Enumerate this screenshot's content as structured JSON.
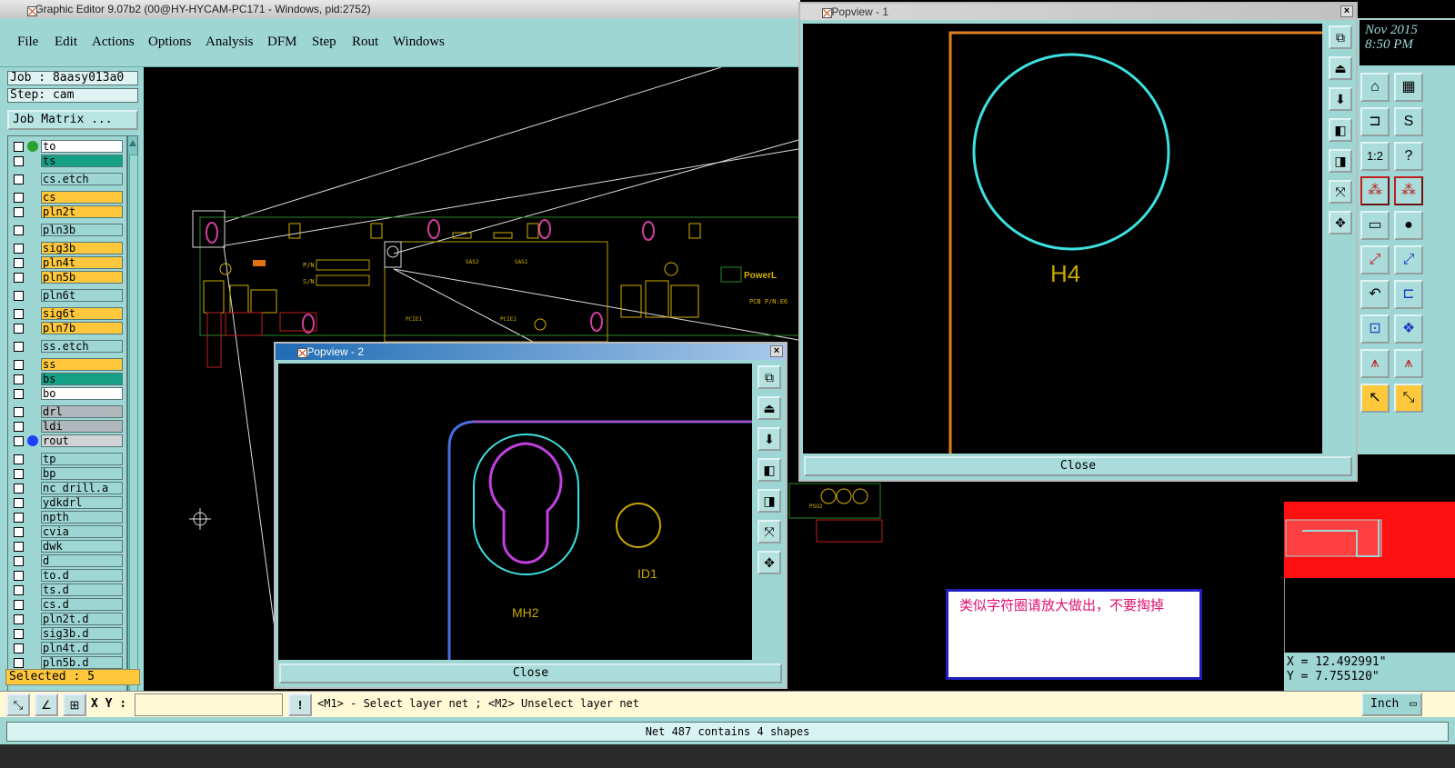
{
  "window": {
    "title": "Graphic Editor 9.07b2 (00@HY-HYCAM-PC171 - Windows, pid:2752)"
  },
  "clock": {
    "date": "Nov 2015",
    "time": "8:50 PM"
  },
  "menu": [
    "File",
    "Edit",
    "Actions",
    "Options",
    "Analysis",
    "DFM",
    "Step",
    "Rout",
    "Windows"
  ],
  "job": {
    "job_label": "Job : 8aasy013a0",
    "step_label": "Step: cam",
    "matrix_button": "Job Matrix ..."
  },
  "layers": [
    {
      "name": "to",
      "color": "#ffffff",
      "dot": "#2ca02c"
    },
    {
      "name": "ts",
      "color": "#16a085"
    },
    {
      "name": "cs.etch",
      "color": "#9ed6d4"
    },
    {
      "name": "cs",
      "color": "#ffc83c"
    },
    {
      "name": "pln2t",
      "color": "#ffc83c"
    },
    {
      "name": "pln3b",
      "color": "#9ed6d4"
    },
    {
      "name": "sig3b",
      "color": "#ffc83c"
    },
    {
      "name": "pln4t",
      "color": "#ffc83c"
    },
    {
      "name": "pln5b",
      "color": "#ffc83c"
    },
    {
      "name": "pln6t",
      "color": "#9ed6d4"
    },
    {
      "name": "sig6t",
      "color": "#ffc83c"
    },
    {
      "name": "pln7b",
      "color": "#ffc83c"
    },
    {
      "name": "ss.etch",
      "color": "#9ed6d4"
    },
    {
      "name": "ss",
      "color": "#ffc83c"
    },
    {
      "name": "bs",
      "color": "#16a085"
    },
    {
      "name": "bo",
      "color": "#ffffff"
    },
    {
      "name": "drl",
      "color": "#b0b8bc"
    },
    {
      "name": "ldi",
      "color": "#b0b8bc"
    },
    {
      "name": "rout",
      "color": "#d0d4d6",
      "dot": "#1f3fff"
    },
    {
      "name": "tp",
      "color": "#9ed6d4"
    },
    {
      "name": "bp",
      "color": "#9ed6d4"
    },
    {
      "name": "nc_drill.a",
      "color": "#9ed6d4"
    },
    {
      "name": "ydkdrl",
      "color": "#9ed6d4"
    },
    {
      "name": "npth",
      "color": "#9ed6d4"
    },
    {
      "name": "cvia",
      "color": "#9ed6d4"
    },
    {
      "name": "dwk",
      "color": "#9ed6d4"
    },
    {
      "name": "d",
      "color": "#9ed6d4"
    },
    {
      "name": "to.d",
      "color": "#9ed6d4"
    },
    {
      "name": "ts.d",
      "color": "#9ed6d4"
    },
    {
      "name": "cs.d",
      "color": "#9ed6d4"
    },
    {
      "name": "pln2t.d",
      "color": "#9ed6d4"
    },
    {
      "name": "sig3b.d",
      "color": "#9ed6d4"
    },
    {
      "name": "pln4t.d",
      "color": "#9ed6d4"
    },
    {
      "name": "pln5b.d",
      "color": "#9ed6d4"
    }
  ],
  "selected": "Selected : 5",
  "popview1": {
    "title": "Popview - 1",
    "close": "Close",
    "label": "H4"
  },
  "popview2": {
    "title": "Popview - 2",
    "close": "Close",
    "label_mh": "MH2",
    "label_id": "ID1"
  },
  "annotation": "类似字符圈请放大做出，不要掏掉",
  "board_labels": {
    "pn": "P/N",
    "sn": "S/N",
    "pcie1": "PCIE1",
    "pcie2": "PCIE2",
    "sas1": "SAS1",
    "sas2": "SAS2",
    "pcb": "PCB P/N:E6",
    "psu2": "PSU2"
  },
  "coords": {
    "x": "X = 12.492991\"",
    "y": "Y = 7.755120\""
  },
  "command": {
    "xy_label": "X Y :",
    "xy_value": "",
    "prompt": "<M1> - Select layer net ; <M2> Unselect layer net",
    "units": "Inch"
  },
  "status": "Net 487 contains 4 shapes",
  "colors": {
    "panel": "#9ed6d4",
    "title_active": "#1f6cb5",
    "highlight": "#ffc83c",
    "canvas": "#000000"
  }
}
